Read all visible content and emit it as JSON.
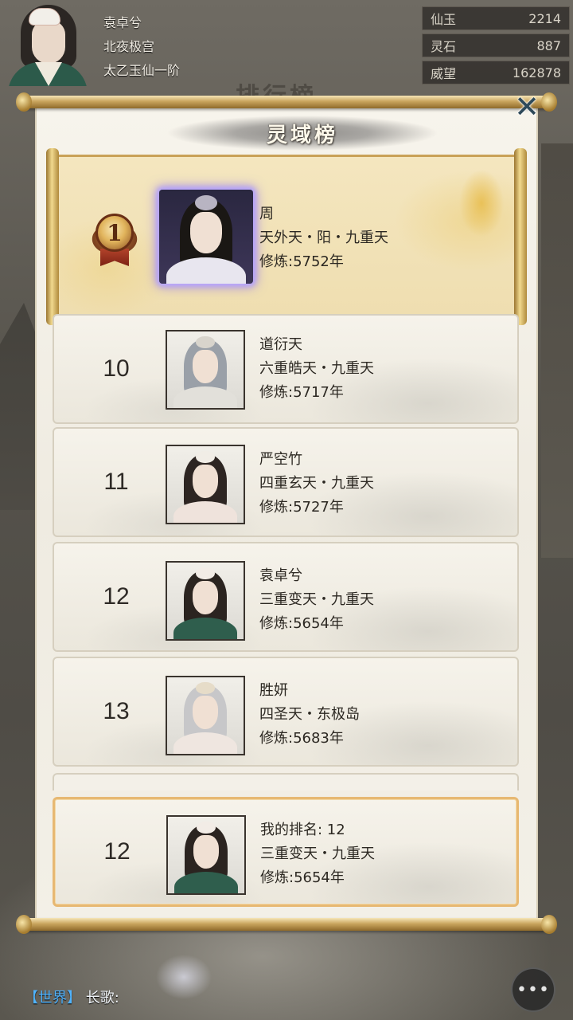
{
  "player": {
    "name": "袁卓兮",
    "sect": "北夜极宫",
    "realm": "太乙玉仙一阶"
  },
  "currencies": [
    {
      "label": "仙玉",
      "value": "2214"
    },
    {
      "label": "灵石",
      "value": "887"
    },
    {
      "label": "威望",
      "value": "162878"
    }
  ],
  "background_title": "排行榜",
  "modal": {
    "title": "灵域榜",
    "close_symbol": "✕"
  },
  "top_rank": {
    "rank": "1",
    "name": "周",
    "realm": "天外天・阳・九重天",
    "cultivation": "修炼:5752年"
  },
  "rankings": [
    {
      "rank": "10",
      "name": "道衍天",
      "realm": "六重皓天・九重天",
      "cultivation": "修炼:5717年"
    },
    {
      "rank": "11",
      "name": "严空竹",
      "realm": "四重玄天・九重天",
      "cultivation": "修炼:5727年"
    },
    {
      "rank": "12",
      "name": "袁卓兮",
      "realm": "三重变天・九重天",
      "cultivation": "修炼:5654年"
    },
    {
      "rank": "13",
      "name": "胜妍",
      "realm": "四圣天・东极岛",
      "cultivation": "修炼:5683年"
    }
  ],
  "my_rank": {
    "rank": "12",
    "label": "我的排名: 12",
    "realm": "三重变天・九重天",
    "cultivation": "修炼:5654年"
  },
  "chat": {
    "channel": "【世界】",
    "speaker": "长歌:"
  },
  "chat_button_icon": "chat-bubble-icon"
}
